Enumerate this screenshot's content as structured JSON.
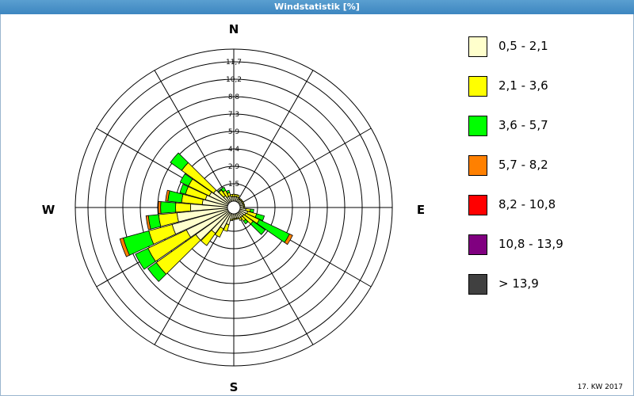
{
  "title": "Windstatistik [%]",
  "footer": "17. KW 2017",
  "chart_data": {
    "type": "radial-stacked-bar",
    "title": "Windstatistik [%]",
    "directions": [
      "N",
      "E",
      "S",
      "W"
    ],
    "radial_ticks": [
      "1,5",
      "2,9",
      "4,4",
      "5,9",
      "7,3",
      "8,8",
      "10,2",
      "11,7"
    ],
    "rmax": 13.2,
    "legend": [
      {
        "label": "0,5 - 2,1",
        "color": "#ffffcc"
      },
      {
        "label": "2,1 - 3,6",
        "color": "#ffff00"
      },
      {
        "label": "3,6 - 5,7",
        "color": "#00ff00"
      },
      {
        "label": "5,7 - 8,2",
        "color": "#ff8000"
      },
      {
        "label": "8,2 - 10,8",
        "color": "#ff0000"
      },
      {
        "label": "10,8 - 13,9",
        "color": "#800080"
      },
      {
        "label": "> 13,9",
        "color": "#404040"
      }
    ],
    "sectors": [
      {
        "dir": 0,
        "values": [
          0.4,
          0.2,
          0.0,
          0,
          0,
          0,
          0
        ]
      },
      {
        "dir": 10,
        "values": [
          0.4,
          0.2,
          0.0,
          0,
          0,
          0,
          0
        ]
      },
      {
        "dir": 20,
        "values": [
          0.4,
          0.2,
          0.0,
          0,
          0,
          0,
          0
        ]
      },
      {
        "dir": 30,
        "values": [
          0.3,
          0.1,
          0.0,
          0,
          0,
          0,
          0
        ]
      },
      {
        "dir": 40,
        "values": [
          0.3,
          0.1,
          0.0,
          0,
          0,
          0,
          0
        ]
      },
      {
        "dir": 50,
        "values": [
          0.3,
          0.1,
          0.0,
          0,
          0,
          0,
          0
        ]
      },
      {
        "dir": 60,
        "values": [
          0.3,
          0.1,
          0.0,
          0,
          0,
          0,
          0
        ]
      },
      {
        "dir": 70,
        "values": [
          0.3,
          0.1,
          0.0,
          0,
          0,
          0,
          0
        ]
      },
      {
        "dir": 80,
        "values": [
          0.3,
          0.1,
          0.0,
          0,
          0,
          0,
          0
        ]
      },
      {
        "dir": 90,
        "values": [
          0.3,
          0.1,
          0.0,
          0,
          0,
          0,
          0
        ]
      },
      {
        "dir": 100,
        "values": [
          0.5,
          0.4,
          0.3,
          0,
          0,
          0,
          0
        ]
      },
      {
        "dir": 110,
        "values": [
          0.7,
          0.8,
          0.7,
          0,
          0,
          0,
          0
        ]
      },
      {
        "dir": 120,
        "values": [
          0.6,
          1.3,
          2.9,
          0.3,
          0,
          0,
          0
        ]
      },
      {
        "dir": 130,
        "values": [
          0.5,
          1.0,
          1.3,
          0,
          0,
          0,
          0
        ]
      },
      {
        "dir": 140,
        "values": [
          0.5,
          0.4,
          0.3,
          0,
          0,
          0,
          0
        ]
      },
      {
        "dir": 150,
        "values": [
          0.5,
          0.2,
          0.0,
          0,
          0,
          0,
          0
        ]
      },
      {
        "dir": 160,
        "values": [
          0.4,
          0.1,
          0.0,
          0,
          0,
          0,
          0
        ]
      },
      {
        "dir": 170,
        "values": [
          0.4,
          0.1,
          0.0,
          0,
          0,
          0,
          0
        ]
      },
      {
        "dir": 180,
        "values": [
          0.4,
          0.1,
          0.0,
          0,
          0,
          0,
          0
        ]
      },
      {
        "dir": 190,
        "values": [
          0.5,
          0.1,
          0.0,
          0,
          0,
          0,
          0
        ]
      },
      {
        "dir": 200,
        "values": [
          1.0,
          0.6,
          0.0,
          0,
          0,
          0,
          0
        ]
      },
      {
        "dir": 210,
        "values": [
          1.5,
          0.8,
          0.0,
          0,
          0,
          0,
          0
        ]
      },
      {
        "dir": 220,
        "values": [
          2.2,
          1.3,
          0.0,
          0,
          0,
          0,
          0
        ]
      },
      {
        "dir": 230,
        "values": [
          3.5,
          4.2,
          0.9,
          0,
          0,
          0,
          0
        ]
      },
      {
        "dir": 240,
        "values": [
          4.0,
          3.7,
          1.2,
          0,
          0,
          0,
          0
        ]
      },
      {
        "dir": 250,
        "values": [
          5.0,
          2.1,
          2.3,
          0.3,
          0,
          0,
          0
        ]
      },
      {
        "dir": 260,
        "values": [
          4.4,
          1.6,
          0.9,
          0.2,
          0,
          0,
          0
        ]
      },
      {
        "dir": 270,
        "values": [
          3.2,
          1.3,
          1.3,
          0.2,
          0,
          0,
          0
        ]
      },
      {
        "dir": 280,
        "values": [
          2.2,
          1.8,
          1.2,
          0.2,
          0,
          0,
          0
        ]
      },
      {
        "dir": 290,
        "values": [
          2.0,
          1.8,
          0.5,
          0,
          0,
          0,
          0
        ]
      },
      {
        "dir": 300,
        "values": [
          1.8,
          2.0,
          0.8,
          0,
          0,
          0,
          0
        ]
      },
      {
        "dir": 310,
        "values": [
          1.6,
          3.4,
          1.2,
          0,
          0,
          0,
          0
        ]
      },
      {
        "dir": 320,
        "values": [
          0.7,
          0.6,
          0.1,
          0,
          0,
          0,
          0
        ]
      },
      {
        "dir": 330,
        "values": [
          0.5,
          0.6,
          0.3,
          0,
          0,
          0,
          0
        ]
      },
      {
        "dir": 340,
        "values": [
          0.5,
          0.3,
          0.2,
          0,
          0,
          0,
          0
        ]
      },
      {
        "dir": 350,
        "values": [
          0.4,
          0.2,
          0.0,
          0,
          0,
          0,
          0
        ]
      }
    ]
  }
}
